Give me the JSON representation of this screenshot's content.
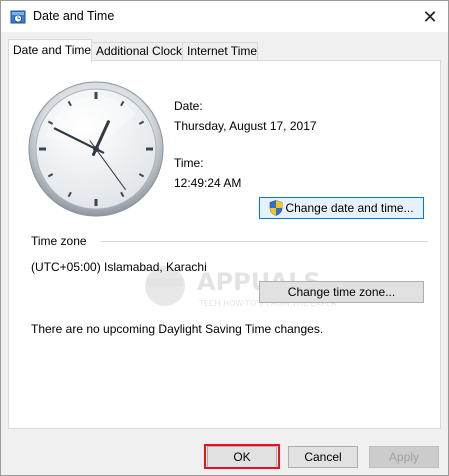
{
  "window": {
    "title": "Date and Time",
    "close_glyph": "✕"
  },
  "tabs": [
    {
      "label": "Date and Time",
      "active": true
    },
    {
      "label": "Additional Clocks",
      "active": false
    },
    {
      "label": "Internet Time",
      "active": false
    }
  ],
  "date_section": {
    "date_label": "Date:",
    "date_value": "Thursday, August 17, 2017",
    "time_label": "Time:",
    "time_value": "12:49:24 AM",
    "change_button": "Change date and time..."
  },
  "timezone_section": {
    "header": "Time zone",
    "value": "(UTC+05:00) Islamabad, Karachi",
    "change_button": "Change time zone..."
  },
  "dst_message": "There are no upcoming Daylight Saving Time changes.",
  "footer": {
    "ok": "OK",
    "cancel": "Cancel",
    "apply": "Apply"
  },
  "watermark": {
    "brand": "APPUALS",
    "tagline": "TECH HOW-TO'S FROM THE EXPERTS!"
  },
  "icons": {
    "title": "clock-window-icon",
    "shield": "uac-shield-icon"
  },
  "colors": {
    "highlight": "#e81123",
    "focus_border": "#0078d7"
  },
  "clock": {
    "hours": 0,
    "minutes": 49,
    "seconds": 24
  }
}
